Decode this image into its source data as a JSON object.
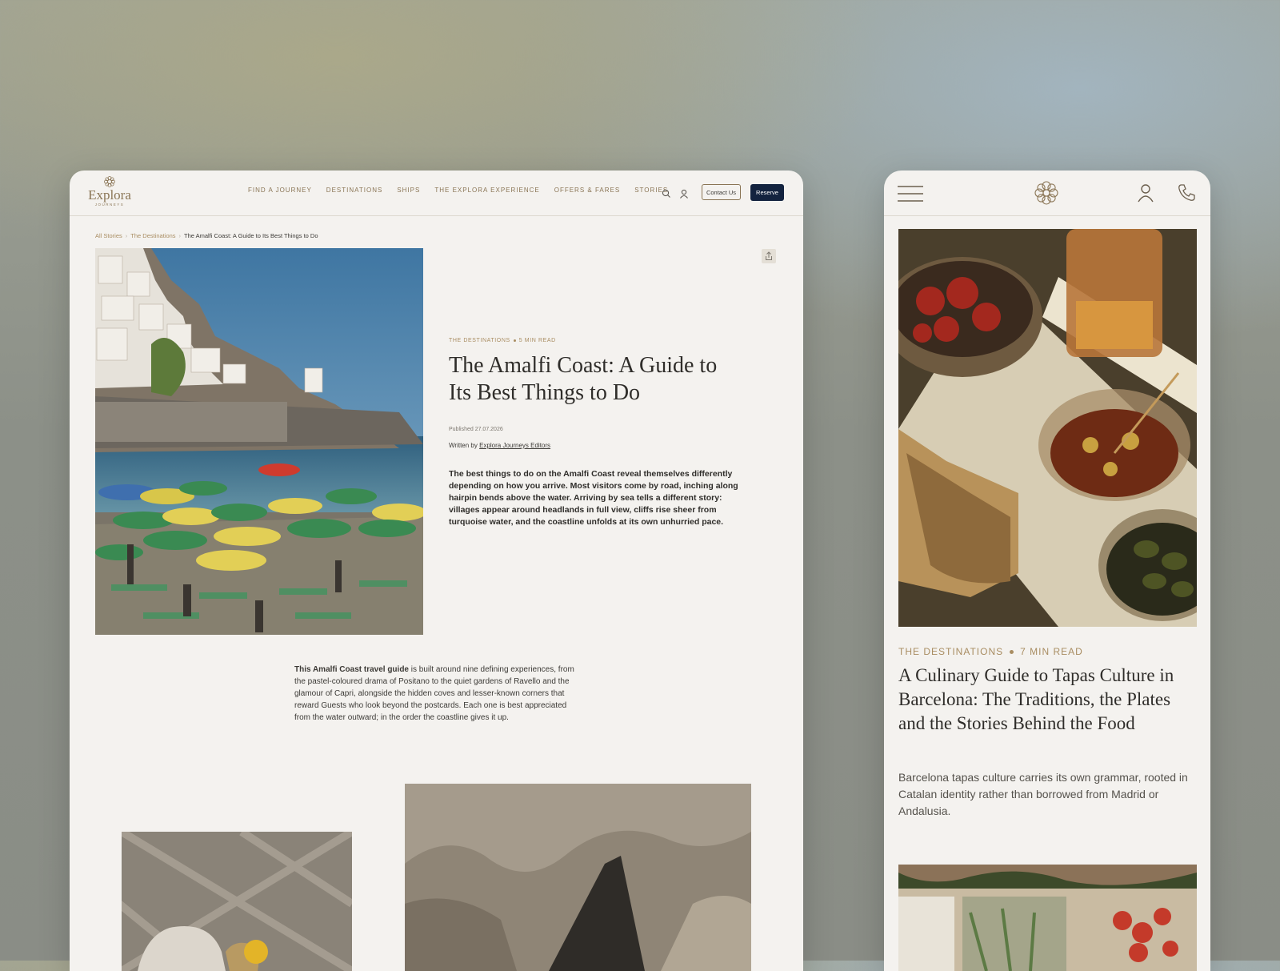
{
  "desktop": {
    "logo": {
      "word": "Explora",
      "sub": "JOURNEYS"
    },
    "nav": [
      "FIND A JOURNEY",
      "DESTINATIONS",
      "SHIPS",
      "THE EXPLORA EXPERIENCE",
      "OFFERS & FARES",
      "STORIES"
    ],
    "contact_label": "Contact Us",
    "reserve_label": "Reserve",
    "breadcrumbs": {
      "all": "All Stories",
      "section": "The Destinations",
      "current": "The Amalfi Coast: A Guide to Its Best Things to Do",
      "separator": "›"
    },
    "article": {
      "category": "THE DESTINATIONS",
      "read_time": "5 MIN READ",
      "title": "The Amalfi Coast: A Guide to Its Best Things to Do",
      "published": "Published 27.07.2026",
      "written_prefix": "Written by",
      "author": "Explora Journeys Editors",
      "lead": "The best things to do on the Amalfi Coast reveal themselves differently depending on how you arrive. Most visitors come by road, inching along hairpin bends above the water. Arriving by sea tells a different story: villages appear around headlands in full view, cliffs rise sheer from turquoise water, and the coastline unfolds at its own unhurried pace.",
      "body_strong": "This Amalfi Coast travel guide",
      "body_rest": " is built around nine defining experiences, from the pastel-coloured drama of Positano to the quiet gardens of Ravello and the glamour of Capri, alongside the hidden coves and lesser-known corners that reward Guests who look beyond the postcards. Each one is best appreciated from the water outward; in the order the coastline gives it up."
    }
  },
  "mobile": {
    "article": {
      "category": "THE DESTINATIONS",
      "read_time": "7 MIN READ",
      "title": "A Culinary Guide to Tapas Culture in Barcelona: The Traditions, the Plates and the Stories Behind the Food",
      "description": "Barcelona tapas culture carries its own grammar, rooted in Catalan identity rather than borrowed from Madrid or Andalusia."
    }
  },
  "icons": [
    "search-icon",
    "user-icon",
    "share-icon",
    "menu-icon",
    "logo-mark-icon",
    "phone-icon"
  ],
  "colors": {
    "gold": "#a98d62",
    "navy": "#13233f",
    "page": "#f4f2ef",
    "text": "#2f2d2a"
  }
}
